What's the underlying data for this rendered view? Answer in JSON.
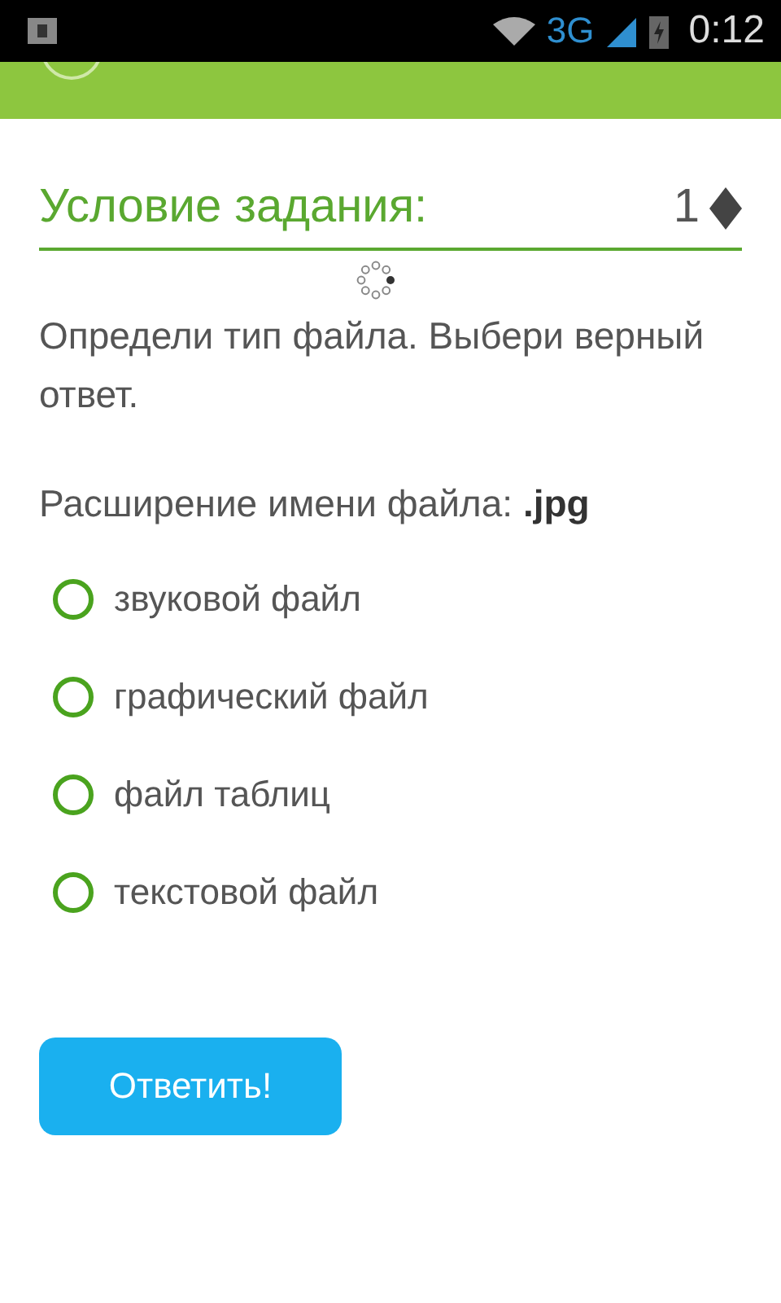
{
  "status_bar": {
    "network": "3G",
    "time": "0:12"
  },
  "header": {
    "title": "Условие задания:",
    "points": "1"
  },
  "question": "Определи тип файла. Выбери верный ответ.",
  "detail": "Расширение имени файла: **.jpg**",
  "options": [
    {
      "label": "звуковой файл",
      "selected": false
    },
    {
      "label": "графический файл",
      "selected": false
    },
    {
      "label": "файл таблиц",
      "selected": false
    },
    {
      "label": "текстовой файл",
      "selected": false
    }
  ],
  "submit": "Ответить!"
}
